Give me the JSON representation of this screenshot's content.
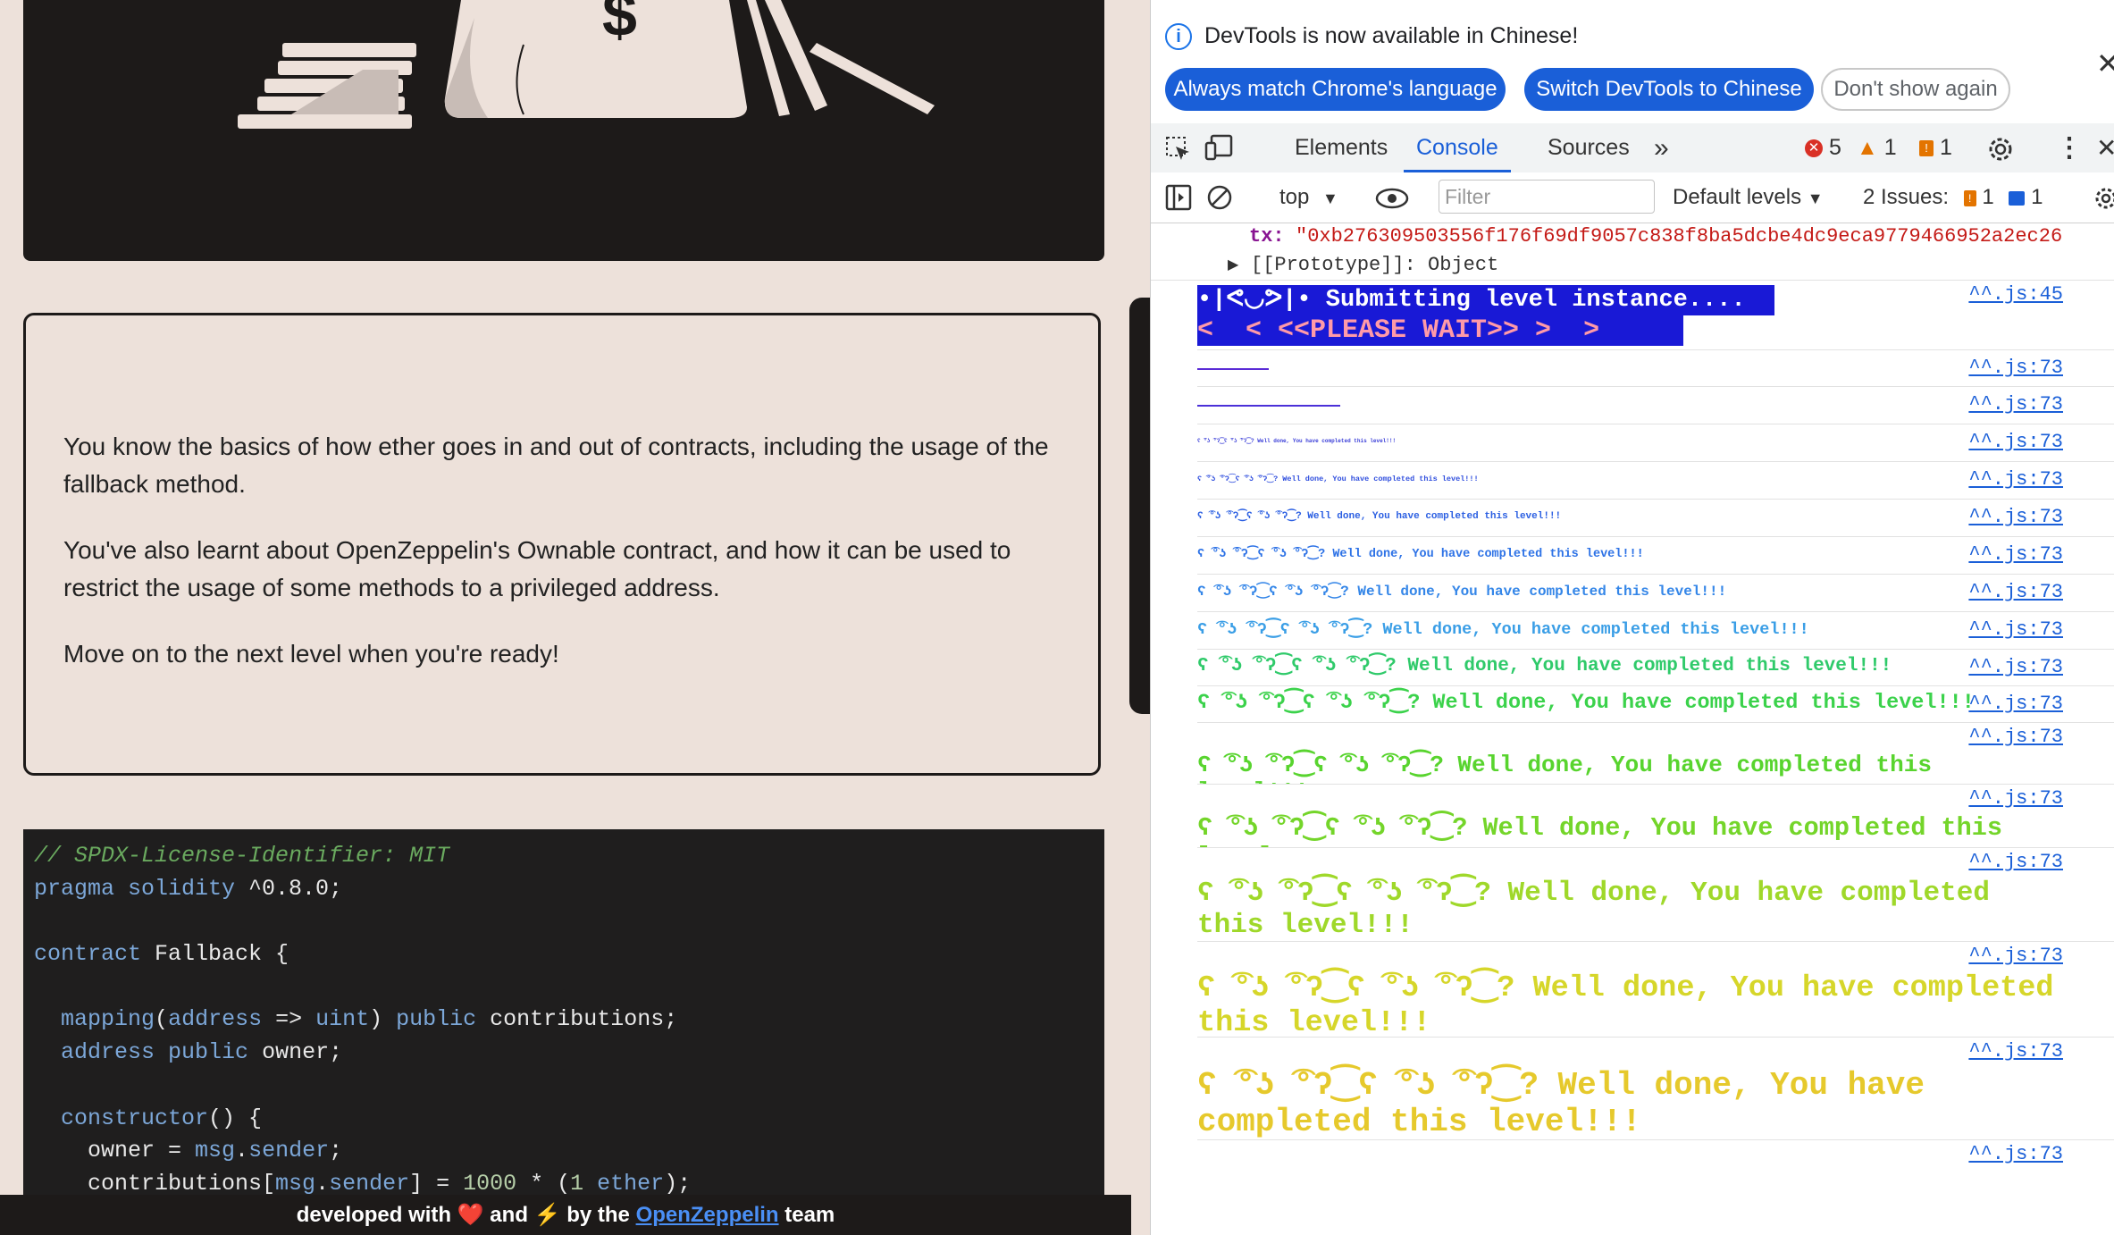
{
  "page": {
    "message": {
      "p1": "You know the basics of how ether goes in and out of contracts, including the usage of the fallback method.",
      "p2": "You've also learnt about OpenZeppelin's Ownable contract, and how it can be used to restrict the usage of some methods to a privileged address.",
      "p3": "Move on to the next level when you're ready!"
    },
    "code_lines": [
      {
        "cls": "cm",
        "t": "// SPDX-License-Identifier: MIT"
      },
      {
        "parts": [
          [
            "kw",
            "pragma solidity "
          ],
          [
            "",
            "^0.8.0;"
          ]
        ]
      },
      {
        "parts": []
      },
      {
        "parts": [
          [
            "kw",
            "contract "
          ],
          [
            "",
            "Fallback {"
          ]
        ]
      },
      {
        "parts": []
      },
      {
        "parts": [
          [
            "",
            "  "
          ],
          [
            "kw",
            "mapping"
          ],
          [
            "",
            "("
          ],
          [
            "kw",
            "address"
          ],
          [
            "",
            " => "
          ],
          [
            "kw",
            "uint"
          ],
          [
            "",
            ") "
          ],
          [
            "kw",
            "public "
          ],
          [
            "",
            "contributions;"
          ]
        ]
      },
      {
        "parts": [
          [
            "",
            "  "
          ],
          [
            "kw",
            "address public "
          ],
          [
            "",
            "owner;"
          ]
        ]
      },
      {
        "parts": []
      },
      {
        "parts": [
          [
            "",
            "  "
          ],
          [
            "kw",
            "constructor"
          ],
          [
            "",
            "() {"
          ]
        ]
      },
      {
        "parts": [
          [
            "",
            "    owner = "
          ],
          [
            "kw",
            "msg"
          ],
          [
            "",
            "."
          ],
          [
            "kw",
            "sender"
          ],
          [
            "",
            ";"
          ]
        ]
      },
      {
        "parts": [
          [
            "",
            "    contributions["
          ],
          [
            "kw",
            "msg"
          ],
          [
            "",
            "."
          ],
          [
            "kw",
            "sender"
          ],
          [
            "",
            "] = "
          ],
          [
            "nu",
            "1000"
          ],
          [
            "",
            " * ("
          ],
          [
            "nu",
            "1"
          ],
          [
            "",
            " "
          ],
          [
            "kw",
            "ether"
          ],
          [
            "",
            ");"
          ]
        ]
      }
    ],
    "footer": {
      "pre": "developed with ",
      "heart": "❤️",
      "mid": " and ",
      "bolt": "⚡",
      "by": " by the ",
      "link": "OpenZeppelin",
      "post": " team"
    }
  },
  "devtools": {
    "infobar": {
      "icon": "i",
      "text": "DevTools is now available in Chinese!",
      "btn_match": "Always match Chrome's language",
      "btn_switch": "Switch DevTools to Chinese",
      "btn_dismiss": "Don't show again",
      "close": "✕"
    },
    "tabs": {
      "elements": "Elements",
      "console": "Console",
      "sources": "Sources",
      "more": "»",
      "errors": "5",
      "warnings": "1",
      "issues": "1"
    },
    "toolbar": {
      "context": "top",
      "filter_placeholder": "Filter",
      "levels": "Default levels",
      "issues_label": "2 Issues:",
      "issues_warn": "1",
      "issues_info": "1"
    },
    "console": {
      "tx_key": "tx:",
      "tx_value": "\"0xb276309503556f176f69df9057c838f8ba5dcbe4dc9eca9779466952a2ec26",
      "prototype": "[[Prototype]]: Object",
      "banner_line1": "•|ᕙ◡ᕗ|• Submitting level instance....",
      "banner_line2": "<  < <<PLEASE WAIT>> >  >",
      "banner_src": "^^.js:45",
      "msg": "ʕ ͡°ʖ ͡°ʔ⁐ʕ ͡°ʖ ͡°ʔ⁐? Well done, You have completed this level!!!",
      "src": "^^.js:73"
    },
    "colors": {
      "accent": "#1a5fd8",
      "error": "#d93025",
      "warning": "#e37400"
    }
  }
}
